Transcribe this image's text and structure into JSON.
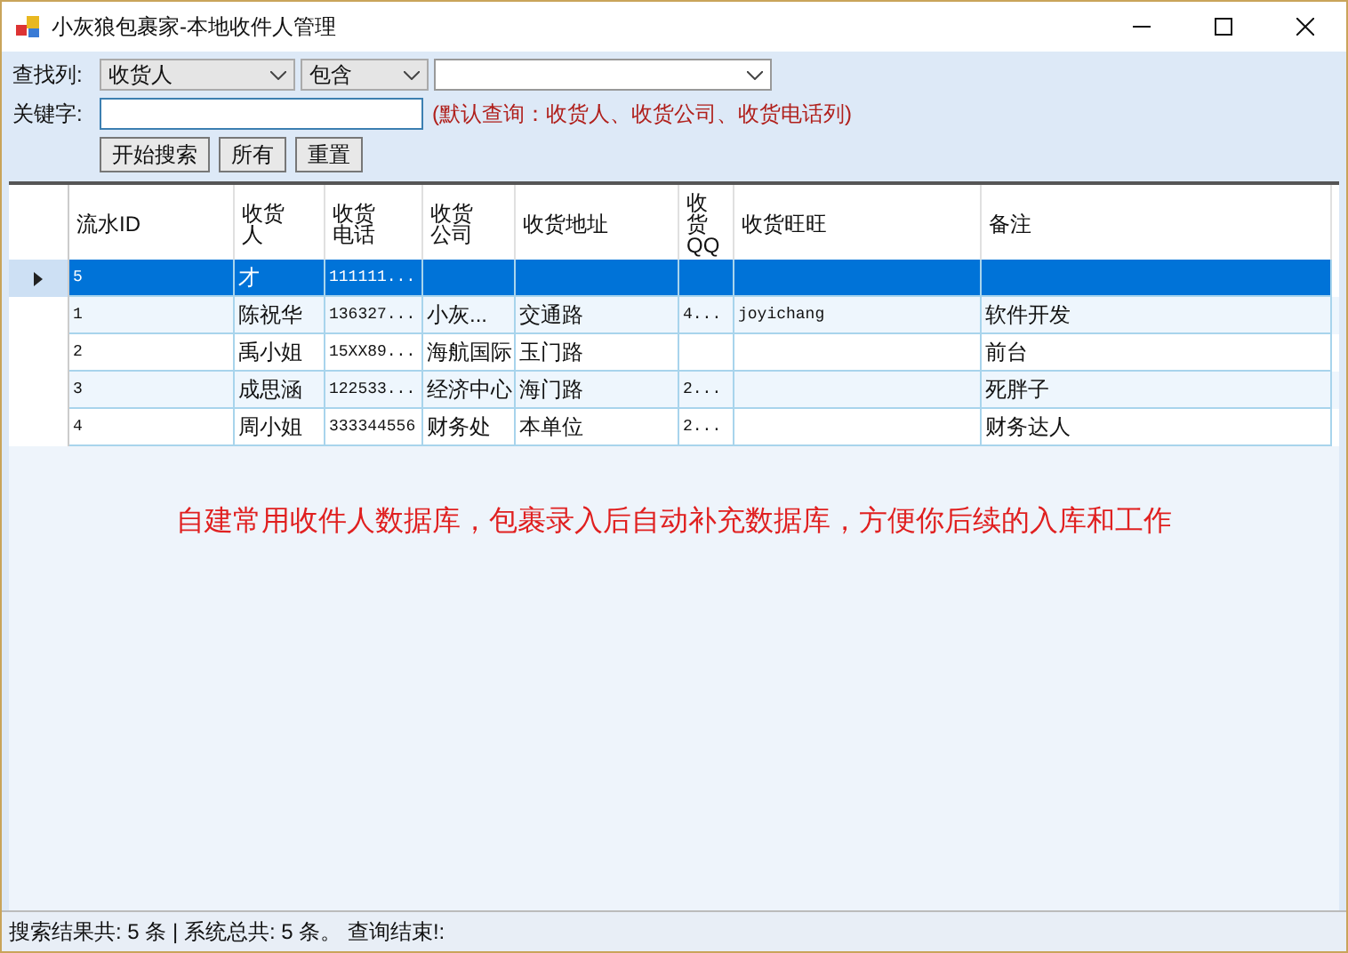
{
  "window": {
    "title": "小灰狼包裹家-本地收件人管理"
  },
  "search": {
    "column_label": "查找列:",
    "column_value": "收货人",
    "operator_value": "包含",
    "keyword_label": "关键字:",
    "hint": "(默认查询：收货人、收货公司、收货电话列)",
    "buttons": [
      "开始搜索",
      "所有",
      "重置"
    ]
  },
  "table": {
    "columns": [
      "流水ID",
      "收货人",
      "收货电话",
      "收货公司",
      "收货地址",
      "收货QQ",
      "收货旺旺",
      "备注"
    ],
    "rows": [
      {
        "selected": true,
        "cells": [
          "5",
          "才",
          "111111...",
          "",
          "",
          "",
          "",
          ""
        ]
      },
      {
        "selected": false,
        "cells": [
          "1",
          "陈祝华",
          "136327...",
          "小灰...",
          "交通路",
          "4...",
          "joyichang",
          "软件开发"
        ]
      },
      {
        "selected": false,
        "cells": [
          "2",
          "禹小姐",
          "15XX89...",
          "海航国际",
          "玉门路",
          "",
          "",
          "前台"
        ]
      },
      {
        "selected": false,
        "cells": [
          "3",
          "成思涵",
          "122533...",
          "经济中心",
          "海门路",
          "2...",
          "",
          "死胖子"
        ]
      },
      {
        "selected": false,
        "cells": [
          "4",
          "周小姐",
          "333344556",
          "财务处",
          "本单位",
          "2...",
          "",
          "财务达人"
        ]
      }
    ]
  },
  "notice": "自建常用收件人数据库，包裹录入后自动补充数据库，方便你后续的入库和工作",
  "status_bar": "搜索结果共: 5 条 | 系统总共: 5 条。 查询结束!:"
}
